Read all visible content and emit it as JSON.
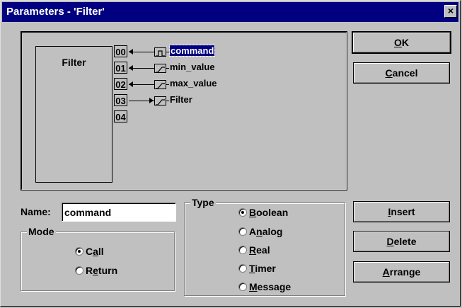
{
  "window": {
    "title": "Parameters - 'Filter'",
    "close_glyph": "×"
  },
  "diagram": {
    "block_label": "Filter",
    "params": [
      {
        "port": "00",
        "name": "command",
        "direction": "in",
        "icon": "boolean-pulse-icon",
        "selected": true
      },
      {
        "port": "01",
        "name": "min_value",
        "direction": "in",
        "icon": "analog-ramp-icon",
        "selected": false
      },
      {
        "port": "02",
        "name": "max_value",
        "direction": "in",
        "icon": "analog-ramp-icon",
        "selected": false
      },
      {
        "port": "03",
        "name": "Filter",
        "direction": "out",
        "icon": "analog-ramp-icon",
        "selected": false
      },
      {
        "port": "04",
        "name": "",
        "direction": "none",
        "icon": "",
        "selected": false
      }
    ]
  },
  "buttons": {
    "ok": "OK",
    "cancel": "Cancel",
    "insert": "Insert",
    "delete": "Delete",
    "arrange": "Arrange"
  },
  "name_field": {
    "label": "Name:",
    "value": "command"
  },
  "mode": {
    "legend": "Mode",
    "options": [
      "Call",
      "Return"
    ],
    "selected": "Call"
  },
  "type": {
    "legend": "Type",
    "options": [
      "Boolean",
      "Analog",
      "Real",
      "Timer",
      "Message"
    ],
    "selected": "Boolean"
  },
  "colors": {
    "titlebar": "#000080",
    "face": "#c0c0c0",
    "selection": "#000080"
  }
}
